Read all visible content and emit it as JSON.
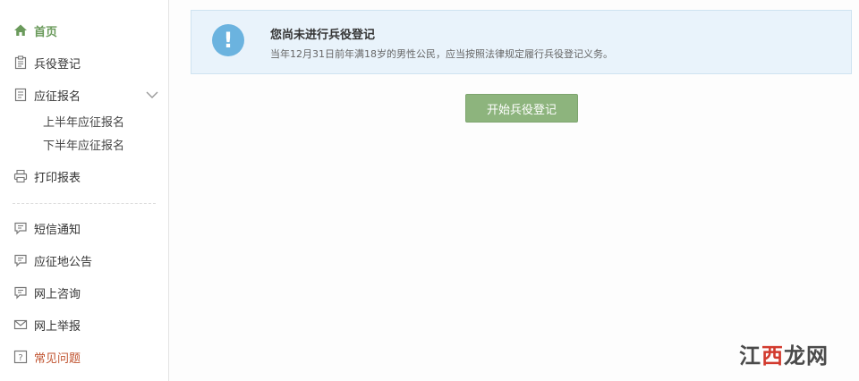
{
  "sidebar": {
    "items": [
      {
        "label": "首页",
        "icon": "home-icon"
      },
      {
        "label": "兵役登记",
        "icon": "clipboard-icon"
      },
      {
        "label": "应征报名",
        "icon": "document-icon"
      },
      {
        "label": "打印报表",
        "icon": "printer-icon"
      },
      {
        "label": "短信通知",
        "icon": "message-icon"
      },
      {
        "label": "应征地公告",
        "icon": "message-icon"
      },
      {
        "label": "网上咨询",
        "icon": "message-icon"
      },
      {
        "label": "网上举报",
        "icon": "mail-icon"
      },
      {
        "label": "常见问题",
        "icon": "question-icon"
      }
    ],
    "sub_items": [
      "上半年应征报名",
      "下半年应征报名"
    ],
    "active_color": "#6a9a5b",
    "warn_color": "#c0532f"
  },
  "notice": {
    "title": "您尚未进行兵役登记",
    "description": "当年12月31日前年满18岁的男性公民，应当按照法律规定履行兵役登记义务。",
    "icon": "exclamation-icon",
    "background": "#e9f3fb"
  },
  "actions": {
    "start_label": "开始兵役登记",
    "button_color": "#8db47d"
  },
  "watermark": {
    "part1": "江",
    "part2": "西",
    "part3": "龙网"
  }
}
